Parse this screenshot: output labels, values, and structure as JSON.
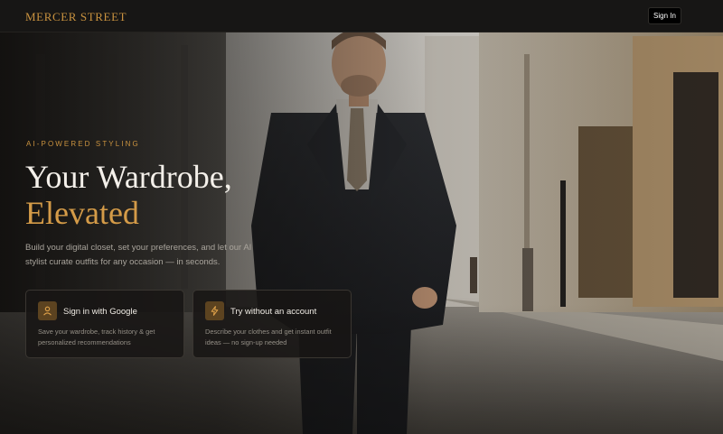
{
  "header": {
    "brand": "MERCER STREET",
    "signin_label": "Sign In"
  },
  "hero": {
    "eyebrow": "AI-POWERED STYLING",
    "headline_line1": "Your Wardrobe,",
    "headline_line2": "Elevated",
    "subtitle": "Build your digital closet, set your preferences, and let our AI stylist curate outfits for any occasion — in seconds."
  },
  "cards": [
    {
      "icon": "user-icon",
      "title": "Sign in with Google",
      "description": "Save your wardrobe, track history & get personalized recommendations"
    },
    {
      "icon": "lightning-icon",
      "title": "Try without an account",
      "description": "Describe your clothes and get instant outfit ideas — no sign-up needed"
    }
  ],
  "colors": {
    "accent": "#c9923f",
    "headline_accent": "#d49b48",
    "topbar_bg": "#171615",
    "card_bg": "#181614",
    "icon_tile_bg": "#5c4320"
  }
}
